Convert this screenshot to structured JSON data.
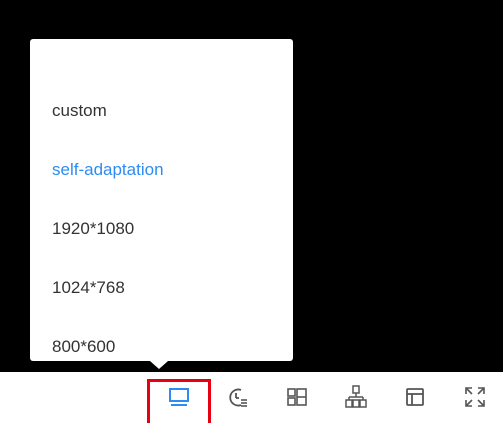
{
  "resolution_menu": {
    "items": [
      {
        "label": "custom",
        "selected": false
      },
      {
        "label": "self-adaptation",
        "selected": true
      },
      {
        "label": "1920*1080",
        "selected": false
      },
      {
        "label": "1024*768",
        "selected": false
      },
      {
        "label": "800*600",
        "selected": false
      }
    ],
    "selected_color": "#2d8cf0",
    "text_color": "#333333"
  },
  "toolbar": {
    "icons": [
      "monitor-icon",
      "timer-icon",
      "grid-layout-icon",
      "network-icon",
      "window-icon",
      "fullscreen-icon"
    ],
    "icon_color": "#555555",
    "active_icon_color": "#2d8cf0",
    "highlight_color": "#e60012"
  }
}
